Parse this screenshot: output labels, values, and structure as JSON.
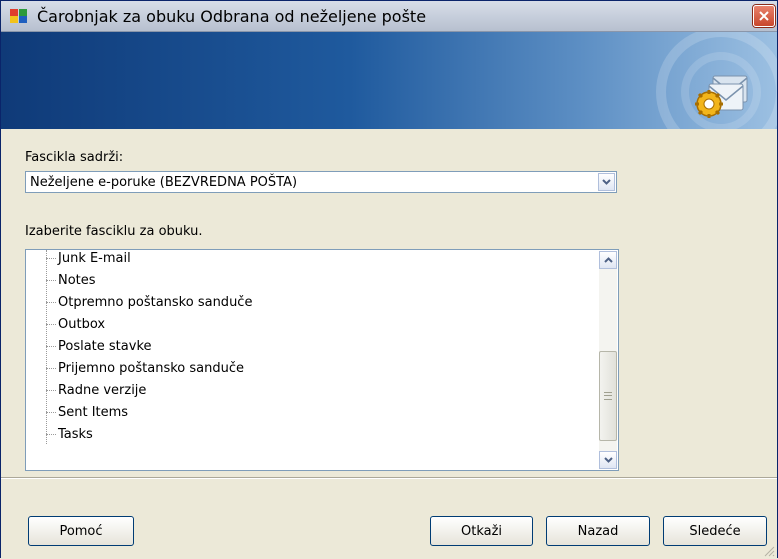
{
  "window": {
    "title": "Čarobnjak za obuku Odbrana od neželjene pošte"
  },
  "folder_select": {
    "label": "Fascikla sadrži:",
    "selected": "Neželjene e-poruke (BEZVREDNA POŠTA)"
  },
  "folder_tree": {
    "label": "Izaberite fasciklu za obuku.",
    "items": [
      "Junk E-mail",
      "Notes",
      "Otpremno poštansko sanduče",
      "Outbox",
      "Poslate stavke",
      "Prijemno poštansko sanduče",
      "Radne verzije",
      "Sent Items",
      "Tasks"
    ]
  },
  "buttons": {
    "help": "Pomoć",
    "cancel": "Otkaži",
    "back": "Nazad",
    "next": "Sledeće"
  },
  "colors": {
    "banner_dark": "#0f3a78",
    "banner_light": "#9cc0e2",
    "close_button": "#c8462c"
  }
}
